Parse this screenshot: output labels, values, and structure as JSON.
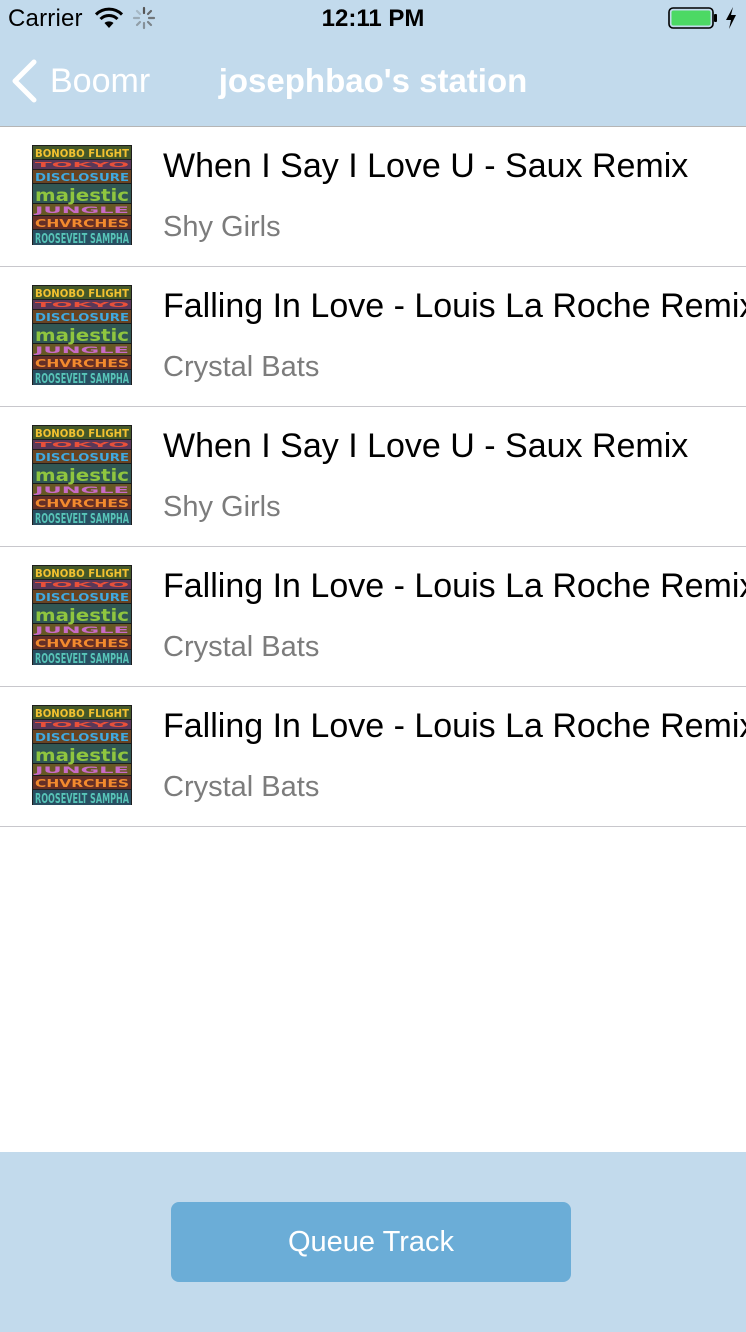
{
  "status_bar": {
    "carrier": "Carrier",
    "time": "12:11 PM",
    "icons": [
      "wifi-icon",
      "activity-spinner-icon",
      "battery-icon",
      "charging-bolt-icon"
    ],
    "battery_color": "#4cd964"
  },
  "nav": {
    "back_label": "Boomr",
    "title": "josephbao's station",
    "back_icon": "chevron-left-icon"
  },
  "tracks": [
    {
      "title": "When I Say I Love U - Saux Remix",
      "artist": "Shy Girls"
    },
    {
      "title": "Falling In Love - Louis La Roche Remix",
      "artist": "Crystal Bats"
    },
    {
      "title": "When I Say I Love U - Saux Remix",
      "artist": "Shy Girls"
    },
    {
      "title": "Falling In Love - Louis La Roche Remix",
      "artist": "Crystal Bats"
    },
    {
      "title": "Falling In Love - Louis La Roche Remix",
      "artist": "Crystal Bats"
    }
  ],
  "artwork": {
    "lines": [
      "BONOBO FLIGHT",
      "TOKYO",
      "DISCLOSURE",
      "majestic",
      "JUNGLE",
      "CHVRCHES",
      "ROOSEVELT SAMPHA"
    ]
  },
  "footer": {
    "queue_label": "Queue Track"
  },
  "colors": {
    "bar_background": "#c2daec",
    "button_background": "#6badd7",
    "artist_text": "#7c7c7c"
  }
}
